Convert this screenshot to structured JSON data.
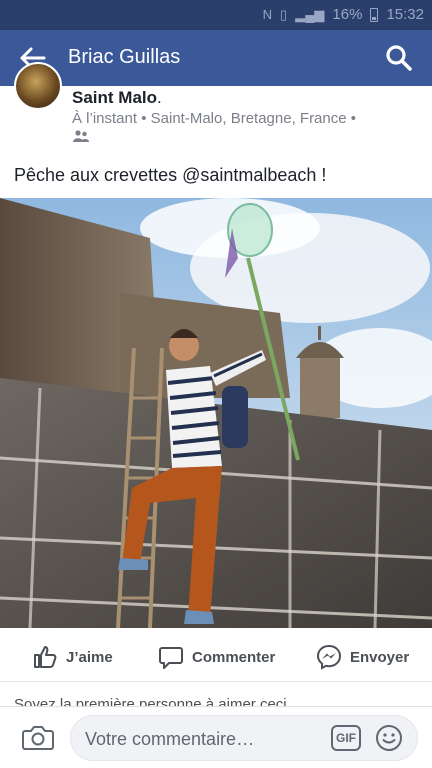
{
  "status_bar": {
    "battery": "16%",
    "time": "15:32",
    "icons": [
      "nfc-icon",
      "vibrate-icon",
      "signal-icon",
      "battery-icon"
    ]
  },
  "app_bar": {
    "title": "Briac Guillas",
    "back_icon": "back-arrow-icon",
    "search_icon": "search-icon",
    "color": "#3b5998"
  },
  "post": {
    "author": "Saint Malo",
    "author_suffix": ".",
    "time": "À l’instant",
    "location": "Saint-Malo, Bretagne, France",
    "separator": "•",
    "caption": "Pêche aux crevettes @saintmalbeach !"
  },
  "actions": {
    "like": "J’aime",
    "comment": "Commenter",
    "send": "Envoyer"
  },
  "likes_summary": "Soyez la première personne à aimer ceci",
  "comment_bar": {
    "placeholder": "Votre commentaire…",
    "gif_label": "GIF"
  }
}
